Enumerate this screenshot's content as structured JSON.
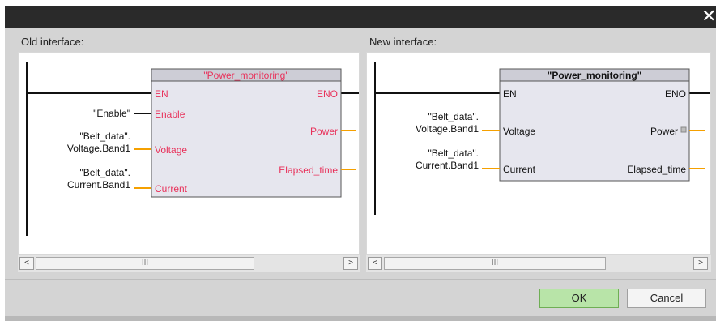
{
  "title_bar": {
    "close_icon": "close-icon"
  },
  "old_interface": {
    "label": "Old interface:",
    "block_name": "\"Power_monitoring\"",
    "en_pin": "EN",
    "eno_pin": "ENO",
    "inputs": [
      {
        "pin": "Enable",
        "operand": [
          "\"Enable\""
        ]
      },
      {
        "pin": "Voltage",
        "operand": [
          "\"Belt_data\".",
          "Voltage.Band1"
        ]
      },
      {
        "pin": "Current",
        "operand": [
          "\"Belt_data\".",
          "Current.Band1"
        ]
      }
    ],
    "outputs": [
      "Power",
      "Elapsed_time"
    ]
  },
  "new_interface": {
    "label": "New interface:",
    "block_name": "\"Power_monitoring\"",
    "en_pin": "EN",
    "eno_pin": "ENO",
    "inputs": [
      {
        "pin": "Voltage",
        "operand": [
          "\"Belt_data\".",
          "Voltage.Band1"
        ]
      },
      {
        "pin": "Current",
        "operand": [
          "\"Belt_data\".",
          "Current.Band1"
        ]
      }
    ],
    "outputs": [
      "Power",
      "Elapsed_time"
    ]
  },
  "scrollbar": {
    "left_arrow": "<",
    "right_arrow": ">",
    "thumb_grip": "III"
  },
  "buttons": {
    "ok": "OK",
    "cancel": "Cancel"
  },
  "colors": {
    "old_text": "#e8315a",
    "new_text": "#111111",
    "wire": "#f5a000",
    "block_bg": "#e6e6ee",
    "block_title_bg": "#cdcdd6"
  }
}
